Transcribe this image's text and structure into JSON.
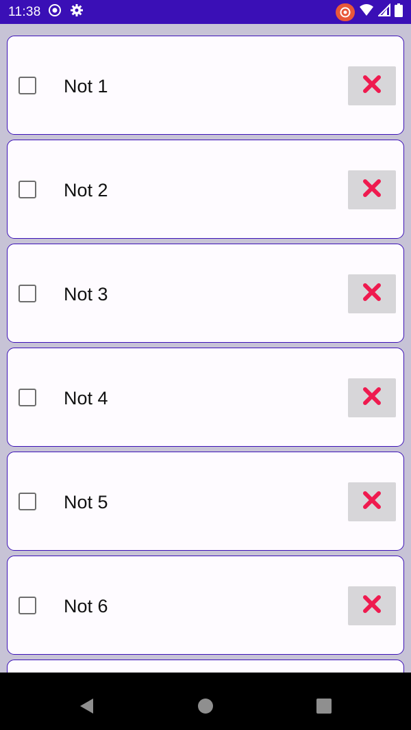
{
  "status_bar": {
    "time": "11:38",
    "left_icons": [
      "screen-record-icon",
      "settings-gear-icon"
    ],
    "right_icons": [
      "app-alert-icon",
      "wifi-icon",
      "cell-signal-icon",
      "battery-icon"
    ],
    "background": "#3a0fb6"
  },
  "notes": {
    "items": [
      {
        "label": "Not 1",
        "checked": false
      },
      {
        "label": "Not 2",
        "checked": false
      },
      {
        "label": "Not 3",
        "checked": false
      },
      {
        "label": "Not 4",
        "checked": false
      },
      {
        "label": "Not 5",
        "checked": false
      },
      {
        "label": "Not 6",
        "checked": false
      },
      {
        "label": "",
        "checked": false
      }
    ],
    "delete_icon": "close-x-icon",
    "accent_color": "#3a0fb6",
    "delete_icon_color": "#ef1a4f"
  },
  "nav_bar": {
    "buttons": [
      "back-triangle-icon",
      "home-circle-icon",
      "recents-square-icon"
    ]
  }
}
